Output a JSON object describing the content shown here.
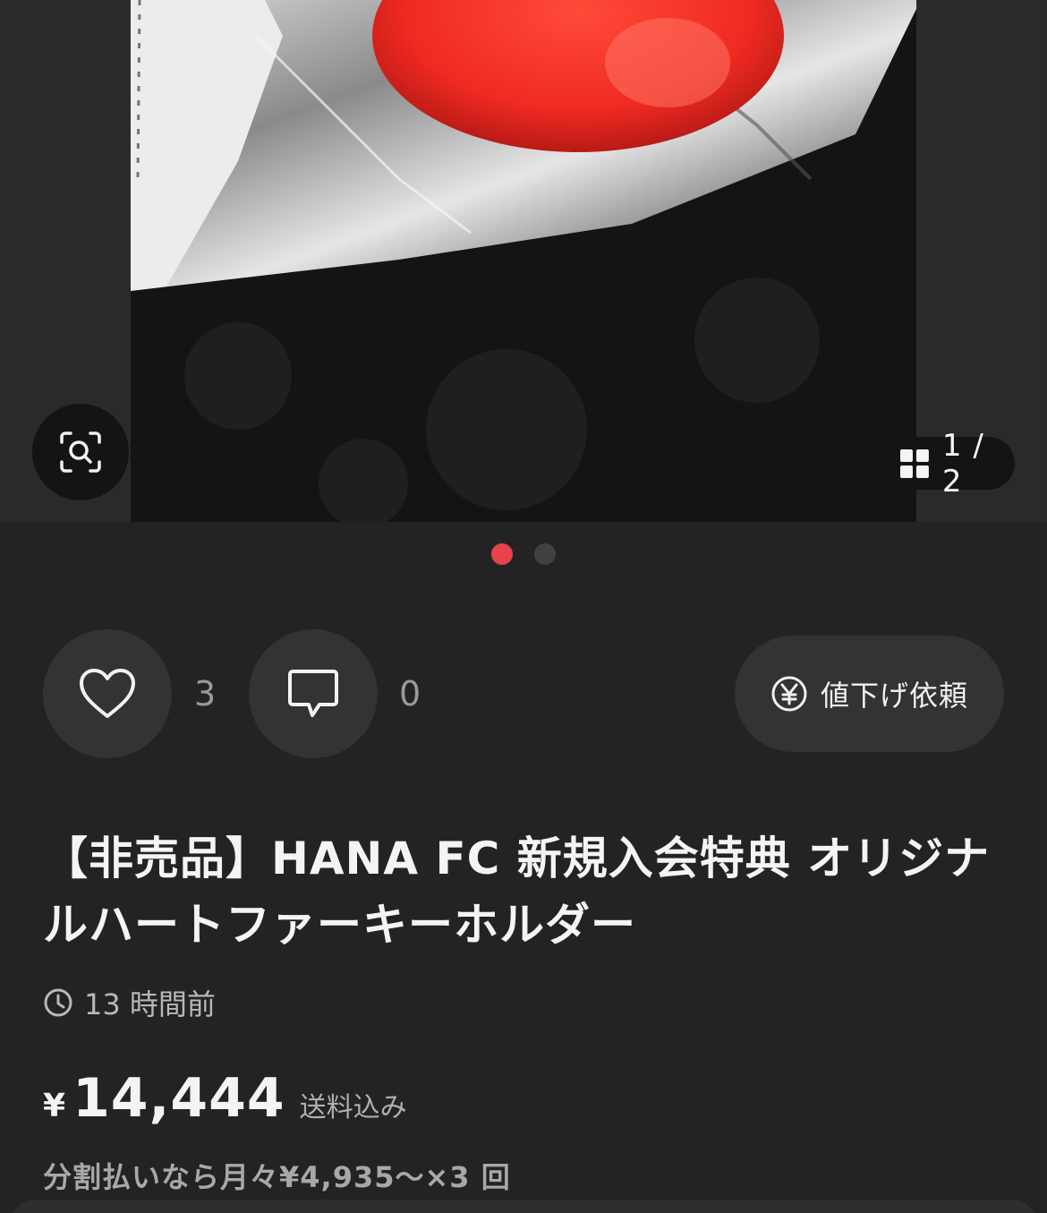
{
  "gallery": {
    "counter": "1 / 2",
    "icons": {
      "lens": "visual-search-icon",
      "grid": "grid-icon"
    },
    "pages": 2,
    "active_page": 1,
    "dot_colors": {
      "active": "#e8424c",
      "inactive": "#414141"
    }
  },
  "actions": {
    "like_count": "3",
    "comment_count": "0",
    "price_request_label": "値下げ依頼",
    "icons": {
      "like": "heart-icon",
      "comment": "comment-icon",
      "price_request": "yen-circle-icon"
    }
  },
  "item": {
    "title": "【非売品】HANA FC 新規入会特典 オリジナルハートファーキーホルダー",
    "posted": "13 時間前",
    "currency_symbol": "¥",
    "price": "14,444",
    "shipping_note": "送料込み",
    "installment": "分割払いなら月々¥4,935〜×3 回"
  },
  "colors": {
    "background": "#232323",
    "button_background": "#333333",
    "accent": "#e8424c"
  }
}
